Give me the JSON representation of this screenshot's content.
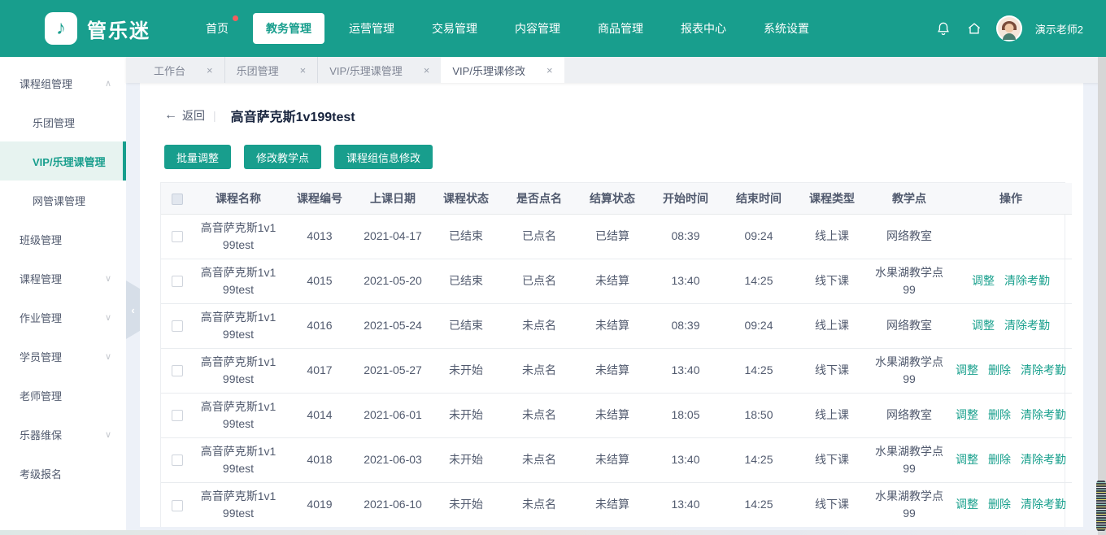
{
  "icons": {
    "close": "×",
    "back": "←",
    "chevron_down": "∨",
    "chevron_up": "∧",
    "collapse": "‹",
    "note": "♪",
    "divider": "|"
  },
  "colors": {
    "accent": "#189e8d",
    "badge": "#f25e5e",
    "link": "#19a08d"
  },
  "navbar": {
    "logo_text": "管乐迷",
    "items": [
      {
        "label": "首页",
        "badge": true
      },
      {
        "label": "教务管理",
        "active": true
      },
      {
        "label": "运营管理"
      },
      {
        "label": "交易管理"
      },
      {
        "label": "内容管理"
      },
      {
        "label": "商品管理"
      },
      {
        "label": "报表中心"
      },
      {
        "label": "系统设置"
      }
    ],
    "username": "演示老师2"
  },
  "sidebar": {
    "items": [
      {
        "label": "课程组管理",
        "type": "group",
        "expanded": true
      },
      {
        "label": "乐团管理",
        "type": "child"
      },
      {
        "label": "VIP/乐理课管理",
        "type": "child",
        "active": true
      },
      {
        "label": "网管课管理",
        "type": "child"
      },
      {
        "label": "班级管理"
      },
      {
        "label": "课程管理",
        "collapsible": true
      },
      {
        "label": "作业管理",
        "collapsible": true
      },
      {
        "label": "学员管理",
        "collapsible": true
      },
      {
        "label": "老师管理"
      },
      {
        "label": "乐器维保",
        "collapsible": true
      },
      {
        "label": "考级报名"
      }
    ]
  },
  "tabs": [
    {
      "label": "工作台"
    },
    {
      "label": "乐团管理"
    },
    {
      "label": "VIP/乐理课管理"
    },
    {
      "label": "VIP/乐理课修改",
      "active": true
    }
  ],
  "page": {
    "back_label": "返回",
    "title": "高音萨克斯1v199test",
    "actions": [
      "批量调整",
      "修改教学点",
      "课程组信息修改"
    ]
  },
  "table": {
    "columns": [
      "课程名称",
      "课程编号",
      "上课日期",
      "课程状态",
      "是否点名",
      "结算状态",
      "开始时间",
      "结束时间",
      "课程类型",
      "教学点",
      "操作"
    ],
    "rows": [
      {
        "name": "高音萨克斯1v199test",
        "id": "4013",
        "date": "2021-04-17",
        "status": "已结束",
        "rollcall": "已点名",
        "settlement": "已结算",
        "start": "08:39",
        "end": "09:24",
        "type": "线上课",
        "location": "网络教室",
        "ops": []
      },
      {
        "name": "高音萨克斯1v199test",
        "id": "4015",
        "date": "2021-05-20",
        "status": "已结束",
        "rollcall": "已点名",
        "settlement": "未结算",
        "start": "13:40",
        "end": "14:25",
        "type": "线下课",
        "location": "水果湖教学点99",
        "ops": [
          "调整",
          "清除考勤"
        ]
      },
      {
        "name": "高音萨克斯1v199test",
        "id": "4016",
        "date": "2021-05-24",
        "status": "已结束",
        "rollcall": "未点名",
        "settlement": "未结算",
        "start": "08:39",
        "end": "09:24",
        "type": "线上课",
        "location": "网络教室",
        "ops": [
          "调整",
          "清除考勤"
        ]
      },
      {
        "name": "高音萨克斯1v199test",
        "id": "4017",
        "date": "2021-05-27",
        "status": "未开始",
        "rollcall": "未点名",
        "settlement": "未结算",
        "start": "13:40",
        "end": "14:25",
        "type": "线下课",
        "location": "水果湖教学点99",
        "ops": [
          "调整",
          "删除",
          "清除考勤"
        ]
      },
      {
        "name": "高音萨克斯1v199test",
        "id": "4014",
        "date": "2021-06-01",
        "status": "未开始",
        "rollcall": "未点名",
        "settlement": "未结算",
        "start": "18:05",
        "end": "18:50",
        "type": "线上课",
        "location": "网络教室",
        "ops": [
          "调整",
          "删除",
          "清除考勤"
        ]
      },
      {
        "name": "高音萨克斯1v199test",
        "id": "4018",
        "date": "2021-06-03",
        "status": "未开始",
        "rollcall": "未点名",
        "settlement": "未结算",
        "start": "13:40",
        "end": "14:25",
        "type": "线下课",
        "location": "水果湖教学点99",
        "ops": [
          "调整",
          "删除",
          "清除考勤"
        ]
      },
      {
        "name": "高音萨克斯1v199test",
        "id": "4019",
        "date": "2021-06-10",
        "status": "未开始",
        "rollcall": "未点名",
        "settlement": "未结算",
        "start": "13:40",
        "end": "14:25",
        "type": "线下课",
        "location": "水果湖教学点99",
        "ops": [
          "调整",
          "删除",
          "清除考勤"
        ]
      }
    ]
  }
}
